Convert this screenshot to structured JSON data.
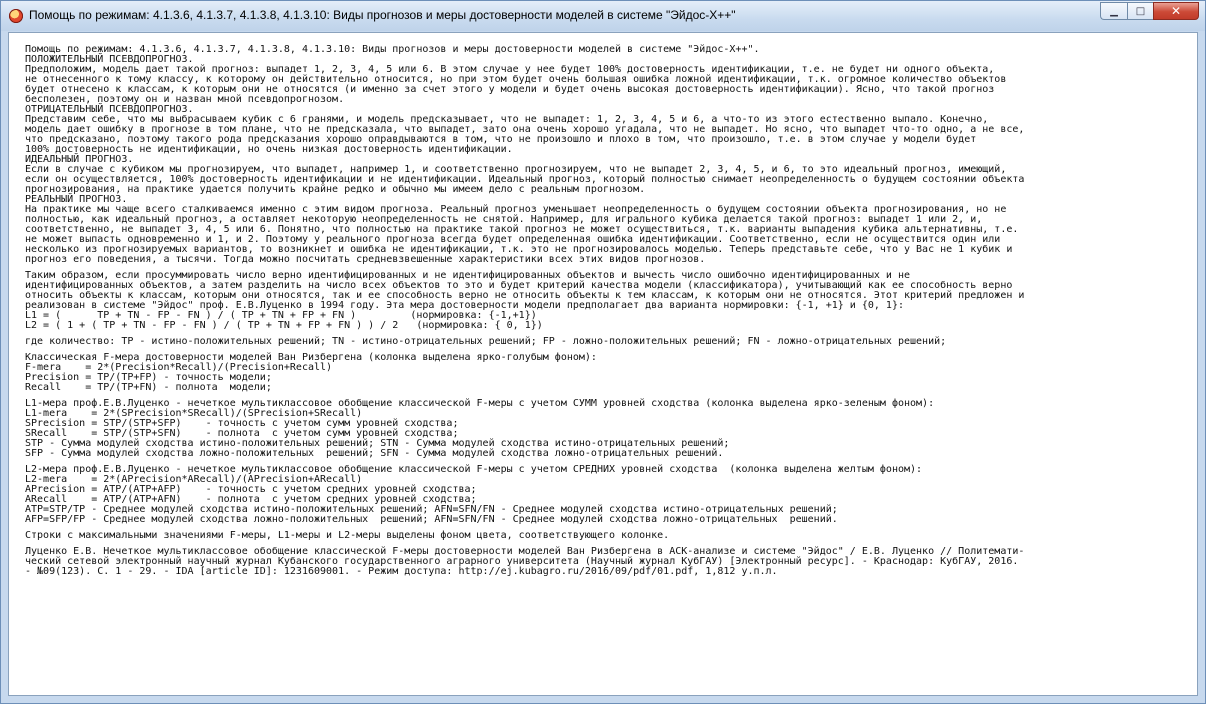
{
  "window": {
    "title": "Помощь по режимам: 4.1.3.6, 4.1.3.7, 4.1.3.8, 4.1.3.10: Виды прогнозов и меры достоверности моделей в системе \"Эйдос-Х++\"",
    "icon": "app-icon",
    "controls": {
      "minimize": "▁",
      "maximize": "□",
      "close": "✕"
    }
  },
  "help_text": {
    "lines": [
      "Помощь по режимам: 4.1.3.6, 4.1.3.7, 4.1.3.8, 4.1.3.10: Виды прогнозов и меры достоверности моделей в системе \"Эйдос-Х++\".",
      "ПОЛОЖИТЕЛЬНЫЙ ПСЕВДОПРОГНОЗ.",
      "Предположим, модель дает такой прогноз: выпадет 1, 2, 3, 4, 5 или 6. В этом случае у нее будет 100% достоверность идентификации, т.е. не будет ни одного объекта,",
      "не отнесенного к тому классу, к которому он действительно относится, но при этом будет очень большая ошибка ложной идентификации, т.к. огромное количество объектов",
      "будет отнесено к классам, к которым они не относятся (и именно за счет этого у модели и будет очень высокая достоверность идентификации). Ясно, что такой прогноз",
      "бесполезен, поэтому он и назван мной псевдопрогнозом.",
      "ОТРИЦАТЕЛЬНЫЙ ПСЕВДОПРОГНОЗ.",
      "Представим себе, что мы выбрасываем кубик с 6 гранями, и модель предсказывает, что не выпадет: 1, 2, 3, 4, 5 и 6, а что-то из этого естественно выпало. Конечно,",
      "модель дает ошибку в прогнозе в том плане, что не предсказала, что выпадет, зато она очень хорошо угадала, что не выпадет. Но ясно, что выпадет что-то одно, а не все,",
      "что предсказано, поэтому такого рода предсказания хорошо оправдываются в том, что не произошло и плохо в том, что произошло, т.е. в этом случае у модели будет",
      "100% достоверность не идентификации, но очень низкая достоверность идентификации.",
      "ИДЕАЛЬНЫЙ ПРОГНОЗ.",
      "Если в случае с кубиком мы прогнозируем, что выпадет, например 1, и соответственно прогнозируем, что не выпадет 2, 3, 4, 5, и 6, то это идеальный прогноз, имеющий,",
      "если он осуществляется, 100% достоверность идентификации и не идентификации. Идеальный прогноз, который полностью снимает неопределенность о будущем состоянии объекта",
      "прогнозирования, на практике удается получить крайне редко и обычно мы имеем дело с реальным прогнозом.",
      "РЕАЛЬНЫЙ ПРОГНОЗ.",
      "На практике мы чаще всего сталкиваемся именно с этим видом прогноза. Реальный прогноз уменьшает неопределенность о будущем состоянии объекта прогнозирования, но не",
      "полностью, как идеальный прогноз, а оставляет некоторую неопределенность не снятой. Например, для игрального кубика делается такой прогноз: выпадет 1 или 2, и,",
      "соответственно, не выпадет 3, 4, 5 или 6. Понятно, что полностью на практике такой прогноз не может осуществиться, т.к. варианты выпадения кубика альтернативны, т.е.",
      "не может выпасть одновременно и 1, и 2. Поэтому у реального прогноза всегда будет определенная ошибка идентификации. Соответственно, если не осуществится один или",
      "несколько из прогнозируемых вариантов, то возникнет и ошибка не идентификации, т.к. это не прогнозировалось моделью. Теперь представьте себе, что у Вас не 1 кубик и",
      "прогноз его поведения, а тысячи. Тогда можно посчитать средневзвешенные характеристики всех этих видов прогнозов.",
      "",
      "Таким образом, если просуммировать число верно идентифицированных и не идентифицированных объектов и вычесть число ошибочно идентифицированных и не",
      "идентифицированных объектов, а затем разделить на число всех объектов то это и будет критерий качества модели (классификатора), учитывающий как ее способность верно",
      "относить объекты к классам, которым они относятся, так и ее способность верно не относить объекты к тем классам, к которым они не относятся. Этот критерий предложен и",
      "реализован в системе \"Эйдос\" проф. Е.В.Луценко в 1994 году. Эта мера достоверности модели предполагает два варианта нормировки: {-1, +1} и {0, 1}:",
      "L1 = (      TP + TN - FP - FN ) / ( TP + TN + FP + FN )         (нормировка: {-1,+1})",
      "L2 = ( 1 + ( TP + TN - FP - FN ) / ( TP + TN + FP + FN ) ) / 2   (нормировка: { 0, 1})",
      "",
      "где количество: TP - истино-положительных решений; TN - истино-отрицательных решений; FP - ложно-положительных решений; FN - ложно-отрицательных решений;",
      "",
      "Классическая F-мера достоверности моделей Ван Ризбергена (колонка выделена ярко-голубым фоном):",
      "F-mera    = 2*(Precision*Recall)/(Precision+Recall)",
      "Precision = TP/(TP+FP) - точность модели;",
      "Recall    = TP/(TP+FN) - полнота  модели;",
      "",
      "L1-мера проф.Е.В.Луценко - нечеткое мультиклассовое обобщение классической F-меры с учетом СУММ уровней сходства (колонка выделена ярко-зеленым фоном):",
      "L1-mera    = 2*(SPrecision*SRecall)/(SPrecision+SRecall)",
      "SPrecision = STP/(STP+SFP)    - точность с учетом сумм уровней сходства;",
      "SRecall    = STP/(STP+SFN)    - полнота  с учетом сумм уровней сходства;",
      "STP - Сумма модулей сходства истино-положительных решений; STN - Сумма модулей сходства истино-отрицательных решений;",
      "SFP - Сумма модулей сходства ложно-положительных  решений; SFN - Сумма модулей сходства ложно-отрицательных решений.",
      "",
      "L2-мера проф.Е.В.Луценко - нечеткое мультиклассовое обобщение классической F-меры с учетом СРЕДНИХ уровней сходства  (колонка выделена желтым фоном):",
      "L2-mera    = 2*(APrecision*ARecall)/(APrecision+ARecall)",
      "APrecision = ATP/(ATP+AFP)    - точность с учетом средних уровней сходства;",
      "ARecall    = ATP/(ATP+AFN)    - полнота  с учетом средних уровней сходства;",
      "ATP=STP/TP - Среднее модулей сходства истино-положительных решений; AFN=SFN/FN - Среднее модулей сходства истино-отрицательных решений;",
      "AFP=SFP/FP - Среднее модулей сходства ложно-положительных  решений; AFN=SFN/FN - Среднее модулей сходства ложно-отрицательных  решений.",
      "",
      "Строки с максимальными значениями F-меры, L1-меры и L2-меры выделены фоном цвета, соответствующего колонке.",
      "",
      "Луценко Е.В. Нечеткое мультиклассовое обобщение классической F-меры достоверности моделей Ван Ризбергена в АСК-анализе и системе \"Эйдос\" / Е.В. Луценко // Политемати-",
      "ческий сетевой электронный научный журнал Кубанского государственного аграрного университета (Научный журнал КубГАУ) [Электронный ресурс]. - Краснодар: КубГАУ, 2016.",
      "- №09(123). С. 1 - 29. - IDA [article ID]: 1231609001. - Режим доступа: http://ej.kubagro.ru/2016/09/pdf/01.pdf, 1,812 у.п.л."
    ]
  }
}
